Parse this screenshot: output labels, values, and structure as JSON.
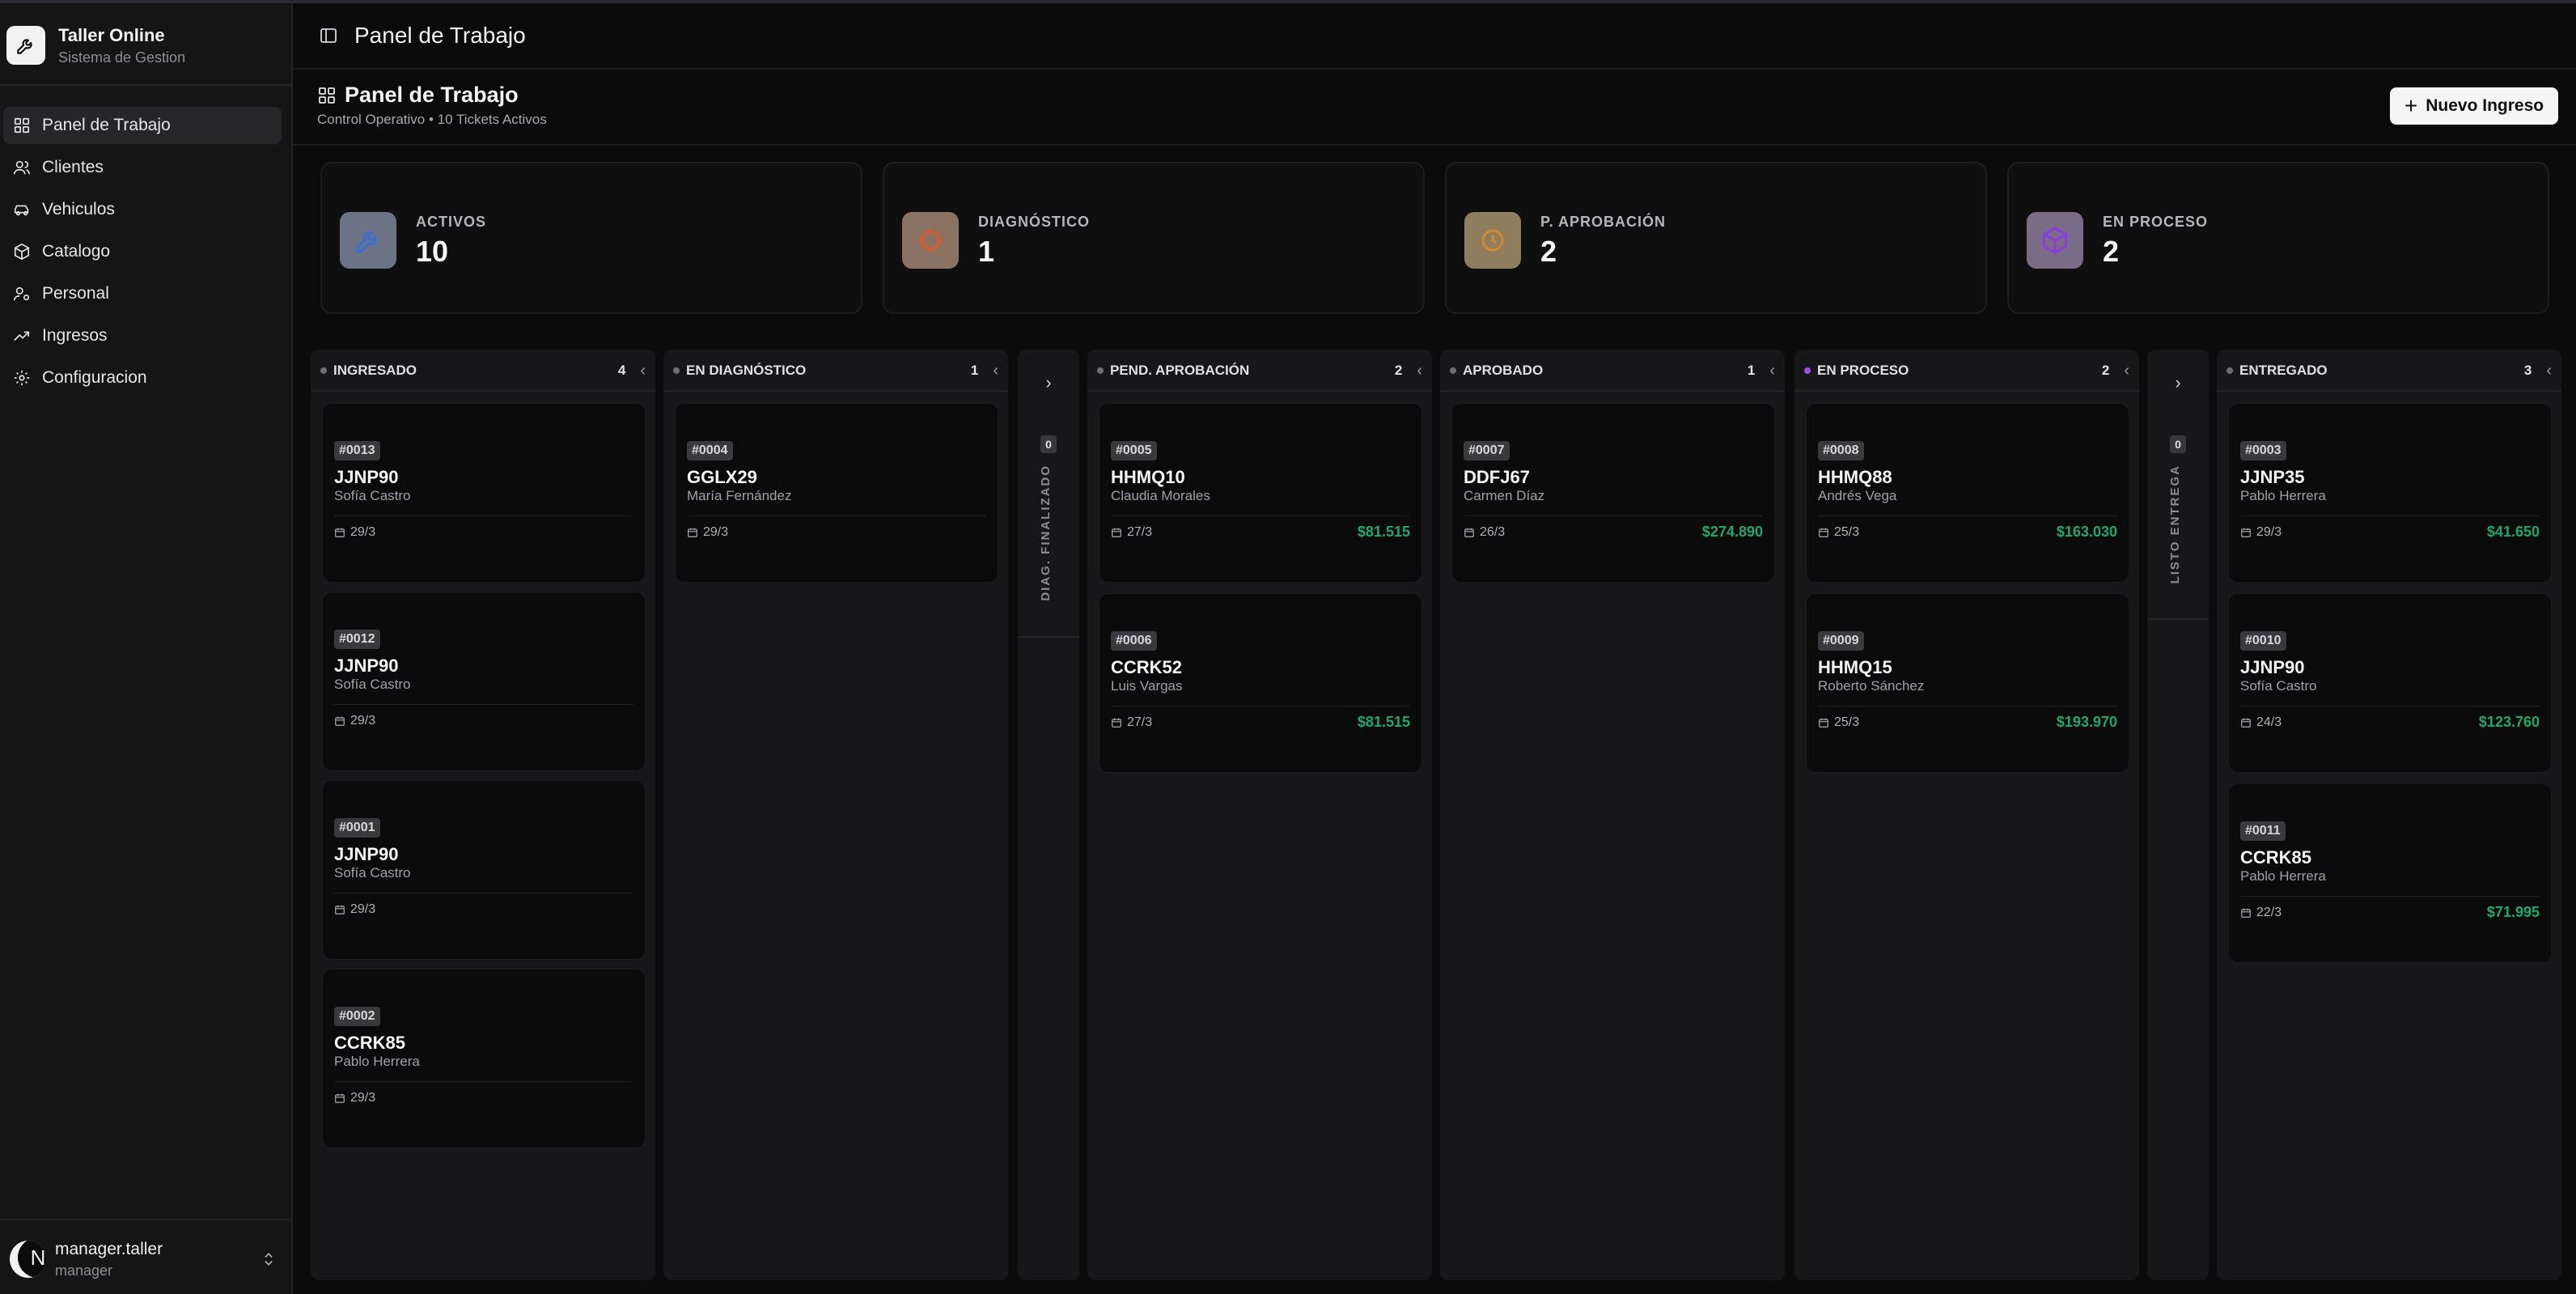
{
  "sidebar": {
    "brand_title": "Taller Online",
    "brand_subtitle": "Sistema de Gestion",
    "items": [
      {
        "label": "Panel de Trabajo",
        "icon": "dashboard-icon",
        "active": true
      },
      {
        "label": "Clientes",
        "icon": "users-icon"
      },
      {
        "label": "Vehiculos",
        "icon": "car-icon"
      },
      {
        "label": "Catalogo",
        "icon": "package-icon"
      },
      {
        "label": "Personal",
        "icon": "user-cog-icon"
      },
      {
        "label": "Ingresos",
        "icon": "trending-up-icon"
      },
      {
        "label": "Configuracion",
        "icon": "gear-icon"
      }
    ],
    "user": {
      "avatar_letter": "N",
      "name": "manager.taller",
      "role": "manager"
    }
  },
  "topbar": {
    "title": "Panel de Trabajo"
  },
  "subheader": {
    "title": "Panel de Trabajo",
    "subtitle": "Control Operativo • 10 Tickets Activos",
    "new_button": "Nuevo Ingreso"
  },
  "stats": [
    {
      "label": "ACTIVOS",
      "value": "10",
      "color": "#3b6fd6",
      "bg": "#6b7385"
    },
    {
      "label": "DIAGNÓSTICO",
      "value": "1",
      "color": "#e2572b",
      "bg": "#8a7362"
    },
    {
      "label": "P. APROBACIÓN",
      "value": "2",
      "color": "#d08a2c",
      "bg": "#8e7d5f"
    },
    {
      "label": "EN PROCESO",
      "value": "2",
      "color": "#8b3be0",
      "bg": "#7a6c87"
    }
  ],
  "columns": [
    {
      "name": "INGRESADO",
      "count": "4",
      "dot": "#6e6e73",
      "cards": [
        {
          "ticket": "#0013",
          "plate": "JJNP90",
          "client": "Sofía Castro",
          "date": "29/3",
          "amount": ""
        },
        {
          "ticket": "#0012",
          "plate": "JJNP90",
          "client": "Sofía Castro",
          "date": "29/3",
          "amount": ""
        },
        {
          "ticket": "#0001",
          "plate": "JJNP90",
          "client": "Sofía Castro",
          "date": "29/3",
          "amount": ""
        },
        {
          "ticket": "#0002",
          "plate": "CCRK85",
          "client": "Pablo Herrera",
          "date": "29/3",
          "amount": ""
        }
      ]
    },
    {
      "name": "EN DIAGNÓSTICO",
      "count": "1",
      "dot": "#6e6e73",
      "cards": [
        {
          "ticket": "#0004",
          "plate": "GGLX29",
          "client": "María Fernández",
          "date": "29/3",
          "amount": ""
        }
      ]
    },
    {
      "name": "PEND. APROBACIÓN",
      "count": "2",
      "dot": "#6e6e73",
      "cards": [
        {
          "ticket": "#0005",
          "plate": "HHMQ10",
          "client": "Claudia Morales",
          "date": "27/3",
          "amount": "$81.515"
        },
        {
          "ticket": "#0006",
          "plate": "CCRK52",
          "client": "Luis Vargas",
          "date": "27/3",
          "amount": "$81.515"
        }
      ]
    },
    {
      "name": "APROBADO",
      "count": "1",
      "dot": "#6e6e73",
      "cards": [
        {
          "ticket": "#0007",
          "plate": "DDFJ67",
          "client": "Carmen Díaz",
          "date": "26/3",
          "amount": "$274.890"
        }
      ]
    },
    {
      "name": "EN PROCESO",
      "count": "2",
      "dot": "#a24be8",
      "cards": [
        {
          "ticket": "#0008",
          "plate": "HHMQ88",
          "client": "Andrés Vega",
          "date": "25/3",
          "amount": "$163.030"
        },
        {
          "ticket": "#0009",
          "plate": "HHMQ15",
          "client": "Roberto Sánchez",
          "date": "25/3",
          "amount": "$193.970"
        }
      ]
    },
    {
      "name": "ENTREGADO",
      "count": "3",
      "dot": "#6e6e73",
      "cards": [
        {
          "ticket": "#0003",
          "plate": "JJNP35",
          "client": "Pablo Herrera",
          "date": "29/3",
          "amount": "$41.650"
        },
        {
          "ticket": "#0010",
          "plate": "JJNP90",
          "client": "Sofía Castro",
          "date": "24/3",
          "amount": "$123.760"
        },
        {
          "ticket": "#0011",
          "plate": "CCRK85",
          "client": "Pablo Herrera",
          "date": "22/3",
          "amount": "$71.995"
        }
      ]
    }
  ],
  "collapsed_columns": [
    {
      "label": "DIAG. FINALIZADO",
      "count": "0"
    },
    {
      "label": "LISTO ENTREGA",
      "count": "0"
    }
  ]
}
